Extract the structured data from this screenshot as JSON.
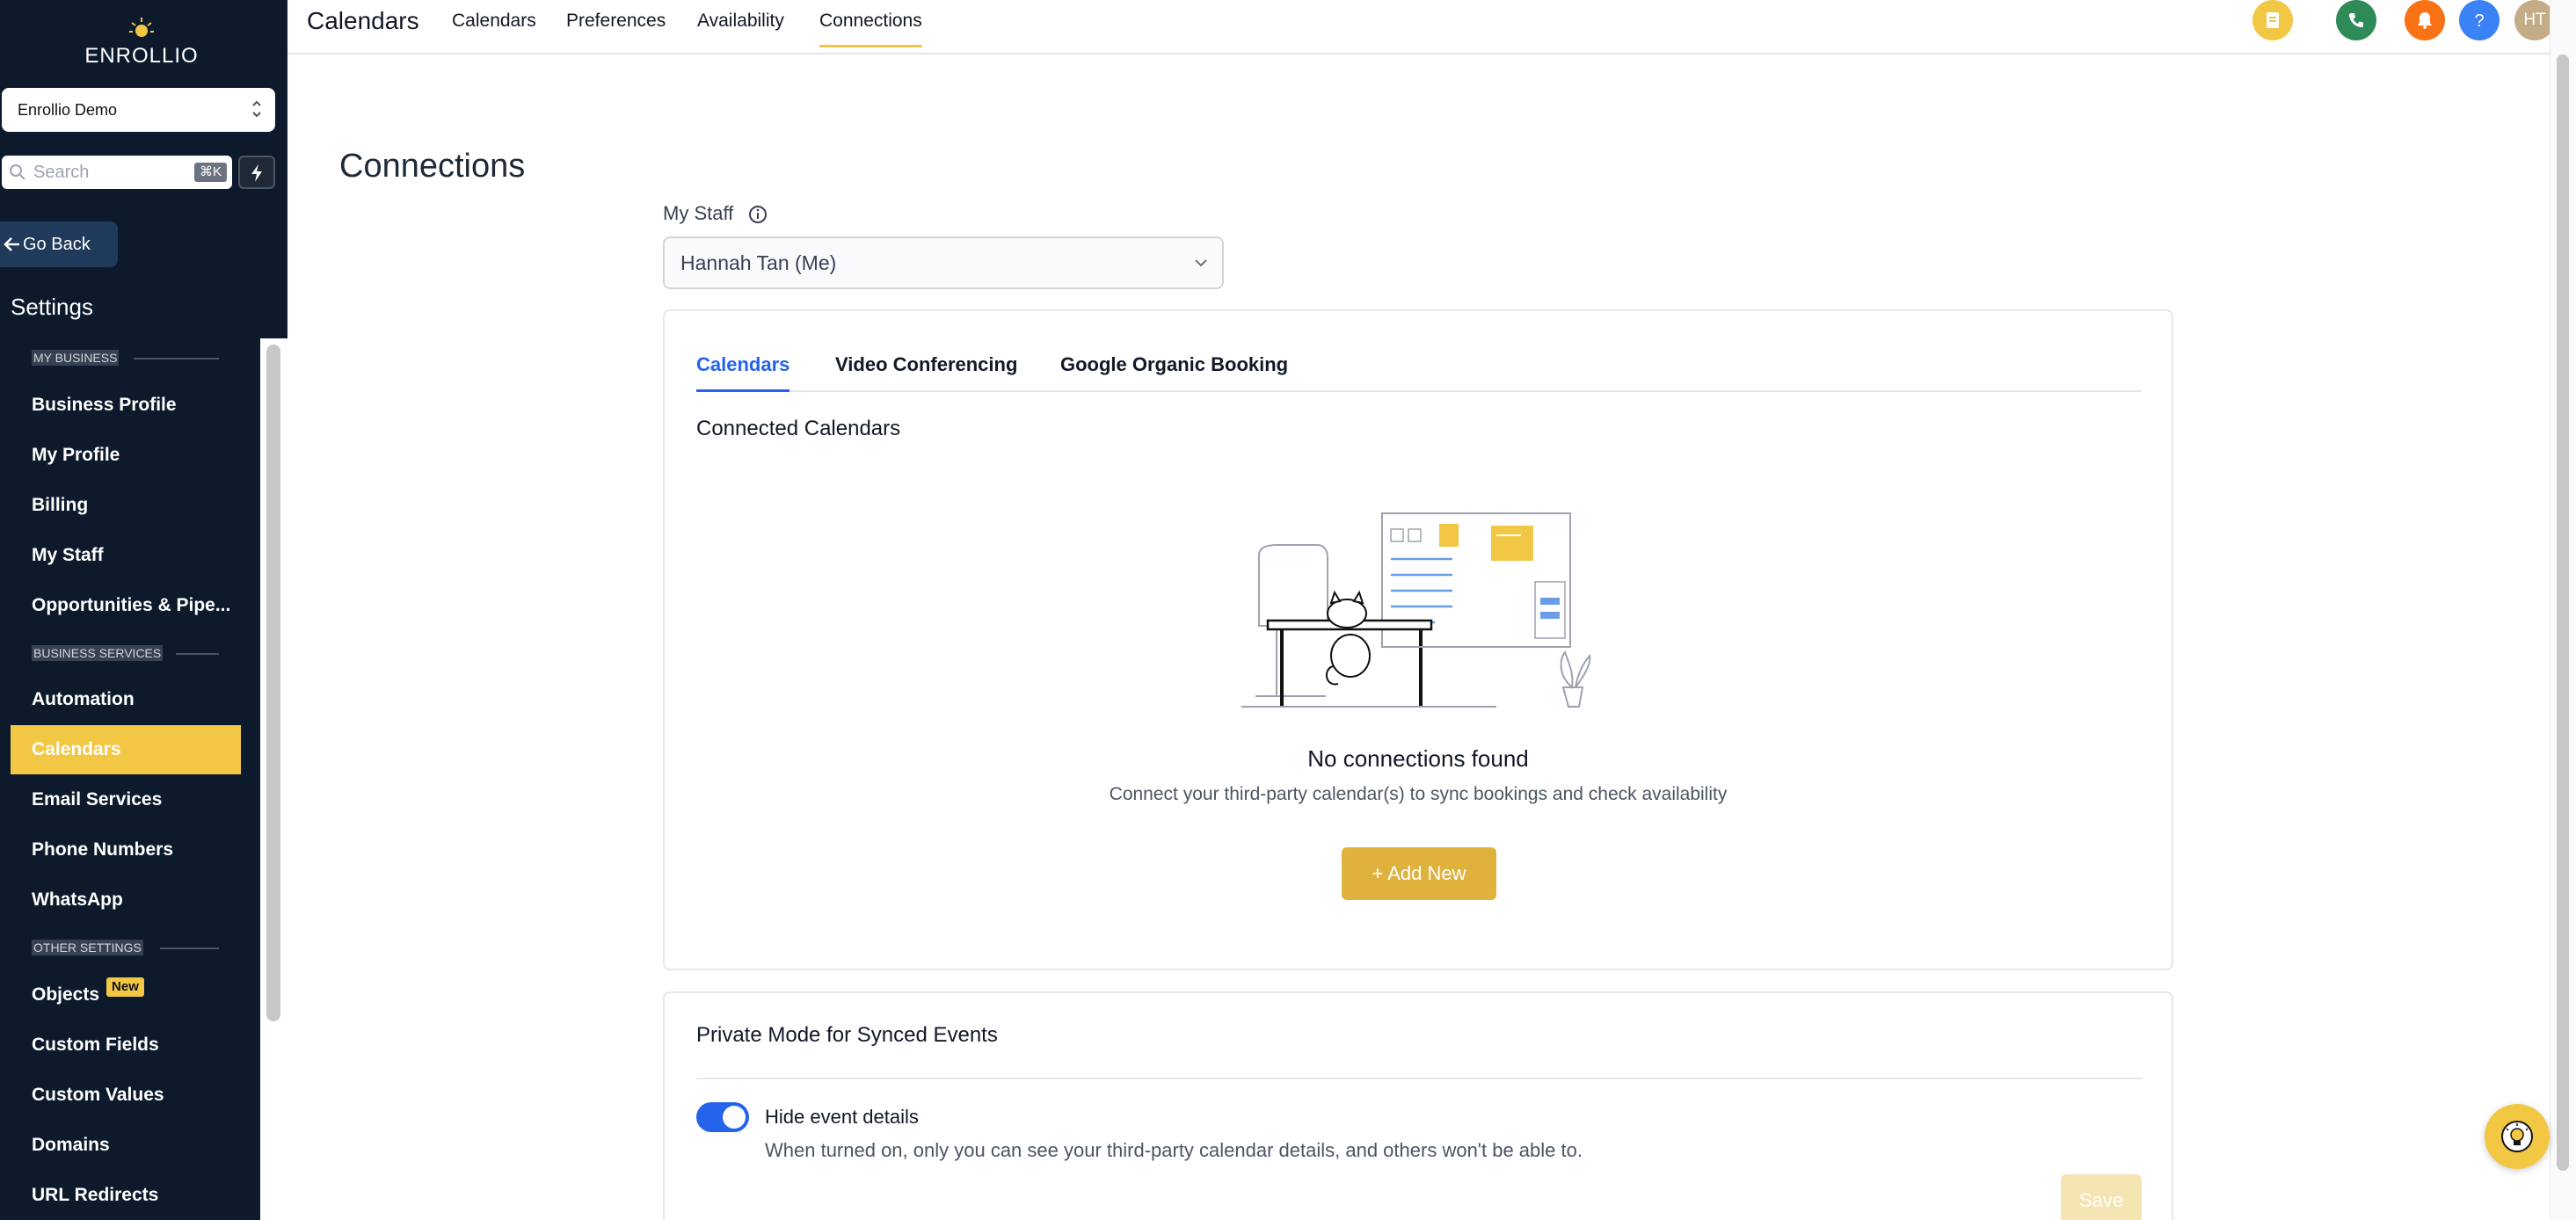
{
  "brand": {
    "wordmark": "ENROLLIO"
  },
  "sidebar": {
    "account": "Enrollio Demo",
    "search_placeholder": "Search",
    "search_shortcut": "⌘K",
    "go_back": "Go Back",
    "settings_title": "Settings",
    "sections": [
      {
        "label": "MY BUSINESS"
      },
      {
        "label": "BUSINESS SERVICES"
      },
      {
        "label": "OTHER SETTINGS"
      }
    ],
    "items": [
      {
        "label": "Business Profile"
      },
      {
        "label": "My Profile"
      },
      {
        "label": "Billing"
      },
      {
        "label": "My Staff"
      },
      {
        "label": "Opportunities & Pipe..."
      },
      {
        "label": "Automation"
      },
      {
        "label": "Calendars"
      },
      {
        "label": "Email Services"
      },
      {
        "label": "Phone Numbers"
      },
      {
        "label": "WhatsApp"
      },
      {
        "label": "Objects",
        "badge": "New"
      },
      {
        "label": "Custom Fields"
      },
      {
        "label": "Custom Values"
      },
      {
        "label": "Domains"
      },
      {
        "label": "URL Redirects"
      }
    ],
    "active_item": "Calendars"
  },
  "topbar": {
    "title": "Calendars",
    "tabs": [
      {
        "label": "Calendars"
      },
      {
        "label": "Preferences"
      },
      {
        "label": "Availability"
      },
      {
        "label": "Connections"
      }
    ],
    "active_tab": "Connections",
    "avatar_initials": "HT",
    "icons": [
      "notes-icon",
      "phone-icon",
      "bell-icon",
      "help-icon"
    ]
  },
  "main": {
    "page_title": "Connections",
    "staff_label": "My Staff",
    "staff_value": "Hannah Tan (Me)",
    "tabs": [
      {
        "label": "Calendars"
      },
      {
        "label": "Video Conferencing"
      },
      {
        "label": "Google Organic Booking"
      }
    ],
    "active_tab": "Calendars",
    "connected_heading": "Connected Calendars",
    "empty_title": "No connections found",
    "empty_subtitle": "Connect your third-party calendar(s) to sync bookings and check availability",
    "add_new": "Add New",
    "private_heading": "Private Mode for Synced Events",
    "toggle_label": "Hide event details",
    "toggle_help": "When turned on, only you can see your third-party calendar details, and others won't be able to.",
    "toggle_on": true,
    "save": "Save"
  },
  "colors": {
    "sidebar_bg": "#0c1a2c",
    "accent_yellow": "#f2c744",
    "primary_blue": "#2563eb",
    "phone_green": "#2e8b57",
    "bell_orange": "#f97316"
  }
}
